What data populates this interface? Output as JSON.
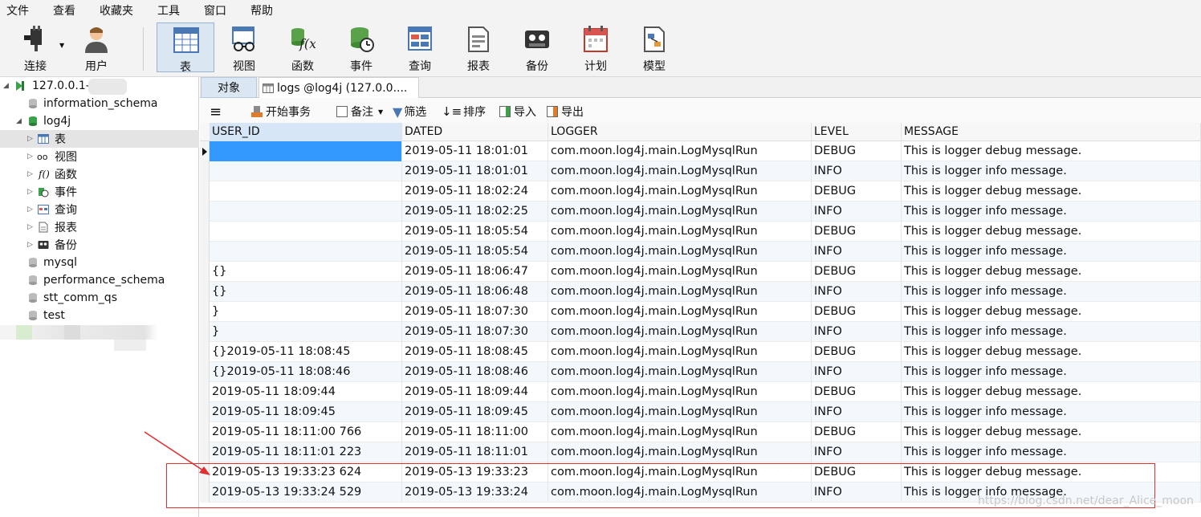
{
  "menu": [
    "文件",
    "查看",
    "收藏夹",
    "工具",
    "窗口",
    "帮助"
  ],
  "toolbar": {
    "connect": "连接",
    "user": "用户",
    "table": "表",
    "view": "视图",
    "function": "函数",
    "event": "事件",
    "query": "查询",
    "report": "报表",
    "backup": "备份",
    "schedule": "计划",
    "model": "模型"
  },
  "tree": {
    "connection": "127.0.0.1-",
    "db_info": "information_schema",
    "db_log4j": "log4j",
    "node_table": "表",
    "node_view": "视图",
    "node_function": "函数",
    "node_event": "事件",
    "node_query": "查询",
    "node_report": "报表",
    "node_backup": "备份",
    "db_mysql": "mysql",
    "db_perf": "performance_schema",
    "db_stt": "stt_comm_qs",
    "db_test": "test"
  },
  "tabs": {
    "objects": "对象",
    "logs": "logs @log4j (127.0.0...."
  },
  "subtoolbar": {
    "begin_tx": "开始事务",
    "note": "备注",
    "filter": "筛选",
    "sort": "排序",
    "import": "导入",
    "export": "导出"
  },
  "grid": {
    "columns": [
      "USER_ID",
      "DATED",
      "LOGGER",
      "LEVEL",
      "MESSAGE"
    ],
    "rows": [
      [
        "",
        "2019-05-11 18:01:01",
        "com.moon.log4j.main.LogMysqlRun",
        "DEBUG",
        "This is logger debug message."
      ],
      [
        "",
        "2019-05-11 18:01:01",
        "com.moon.log4j.main.LogMysqlRun",
        "INFO",
        "This is logger info message."
      ],
      [
        "",
        "2019-05-11 18:02:24",
        "com.moon.log4j.main.LogMysqlRun",
        "DEBUG",
        "This is logger debug message."
      ],
      [
        "",
        "2019-05-11 18:02:25",
        "com.moon.log4j.main.LogMysqlRun",
        "INFO",
        "This is logger info message."
      ],
      [
        "",
        "2019-05-11 18:05:54",
        "com.moon.log4j.main.LogMysqlRun",
        "DEBUG",
        "This is logger debug message."
      ],
      [
        "",
        "2019-05-11 18:05:54",
        "com.moon.log4j.main.LogMysqlRun",
        "INFO",
        "This is logger info message."
      ],
      [
        "{}",
        "2019-05-11 18:06:47",
        "com.moon.log4j.main.LogMysqlRun",
        "DEBUG",
        "This is logger debug message."
      ],
      [
        "{}",
        "2019-05-11 18:06:48",
        "com.moon.log4j.main.LogMysqlRun",
        "INFO",
        "This is logger info message."
      ],
      [
        "}",
        "2019-05-11 18:07:30",
        "com.moon.log4j.main.LogMysqlRun",
        "DEBUG",
        "This is logger debug message."
      ],
      [
        "}",
        "2019-05-11 18:07:30",
        "com.moon.log4j.main.LogMysqlRun",
        "INFO",
        "This is logger info message."
      ],
      [
        "{}2019-05-11 18:08:45",
        "2019-05-11 18:08:45",
        "com.moon.log4j.main.LogMysqlRun",
        "DEBUG",
        "This is logger debug message."
      ],
      [
        "{}2019-05-11 18:08:46",
        "2019-05-11 18:08:46",
        "com.moon.log4j.main.LogMysqlRun",
        "INFO",
        "This is logger info message."
      ],
      [
        "2019-05-11 18:09:44",
        "2019-05-11 18:09:44",
        "com.moon.log4j.main.LogMysqlRun",
        "DEBUG",
        "This is logger debug message."
      ],
      [
        "2019-05-11 18:09:45",
        "2019-05-11 18:09:45",
        "com.moon.log4j.main.LogMysqlRun",
        "INFO",
        "This is logger info message."
      ],
      [
        "2019-05-11 18:11:00 766",
        "2019-05-11 18:11:00",
        "com.moon.log4j.main.LogMysqlRun",
        "DEBUG",
        "This is logger debug message."
      ],
      [
        "2019-05-11 18:11:01 223",
        "2019-05-11 18:11:01",
        "com.moon.log4j.main.LogMysqlRun",
        "INFO",
        "This is logger info message."
      ],
      [
        "2019-05-13 19:33:23 624",
        "2019-05-13 19:33:23",
        "com.moon.log4j.main.LogMysqlRun",
        "DEBUG",
        "This is logger debug message."
      ],
      [
        "2019-05-13 19:33:24 529",
        "2019-05-13 19:33:24",
        "com.moon.log4j.main.LogMysqlRun",
        "INFO",
        "This is logger info message."
      ]
    ]
  },
  "watermark": "https://blog.csdn.net/dear_Alice_moon",
  "colors": {
    "selection": "#3399ff",
    "annotation": "#e03030",
    "db_green": "#3aa34a"
  }
}
